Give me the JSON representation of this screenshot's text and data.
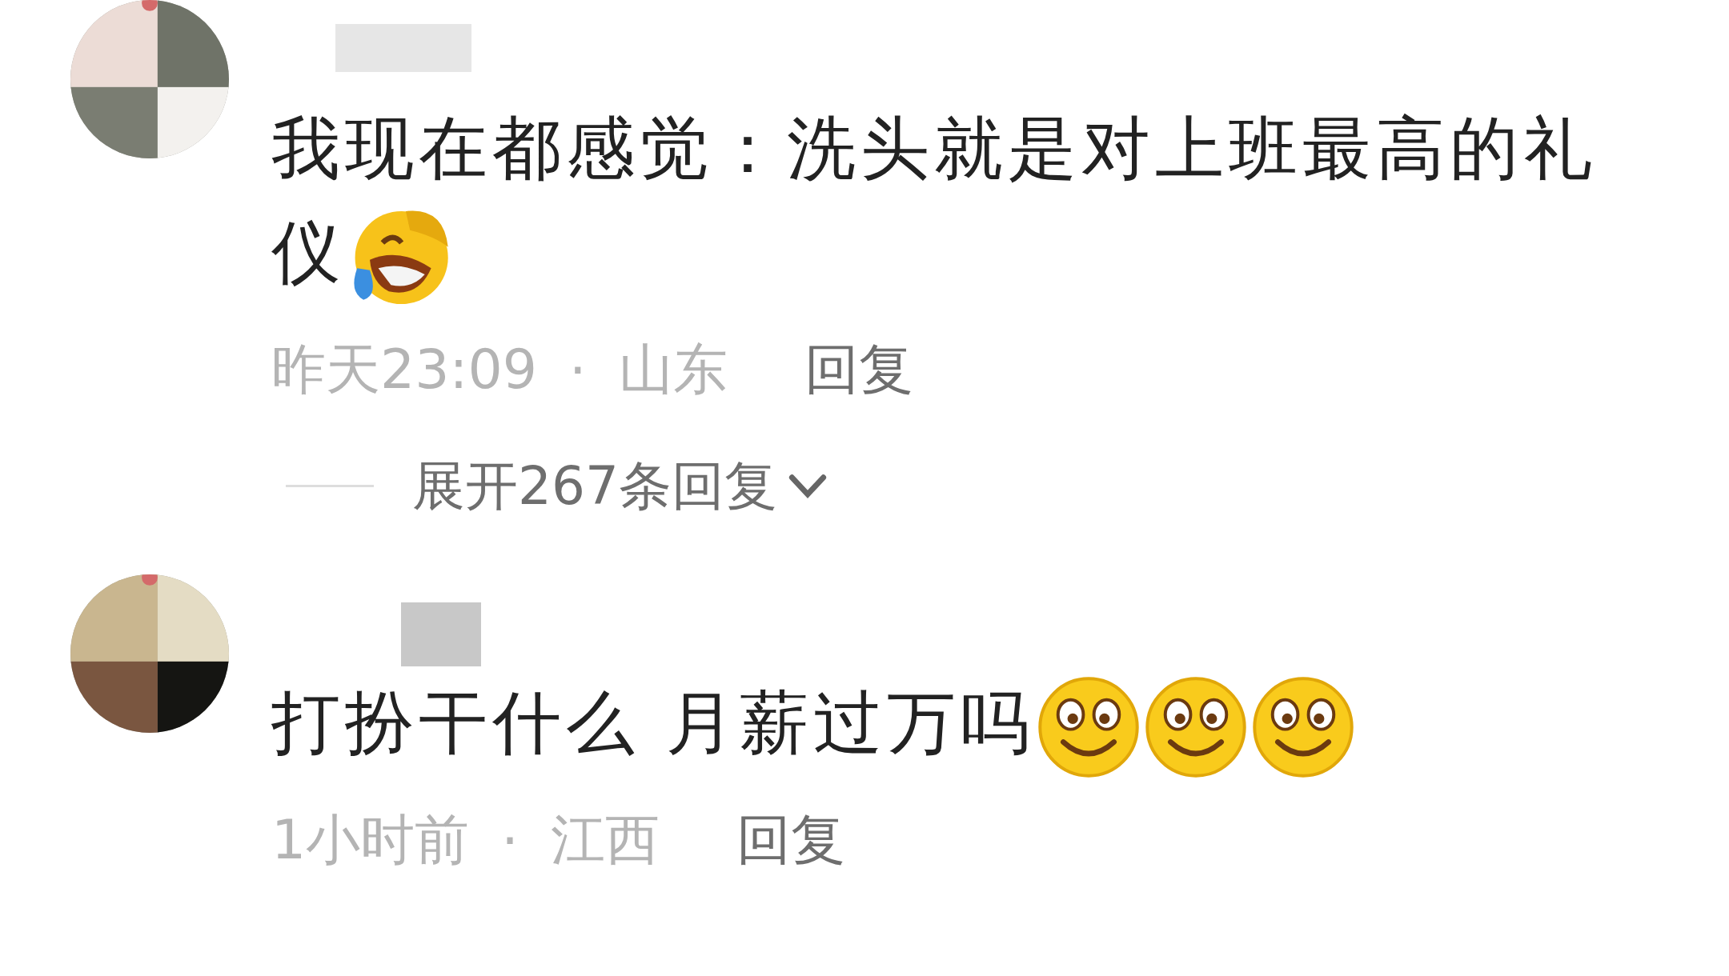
{
  "comments": [
    {
      "text": "我现在都感觉：洗头就是对上班最高的礼仪",
      "emojis": [
        {
          "kind": "rofl"
        }
      ],
      "time": "昨天23:09",
      "separator": "·",
      "location": "山东",
      "reply": "回复",
      "expand": "展开267条回复"
    },
    {
      "text": "打扮干什么 月薪过万吗",
      "emojis": [
        {
          "kind": "smile"
        },
        {
          "kind": "smile"
        },
        {
          "kind": "smile"
        }
      ],
      "time": "1小时前",
      "separator": "·",
      "location": "江西",
      "reply": "回复"
    }
  ]
}
